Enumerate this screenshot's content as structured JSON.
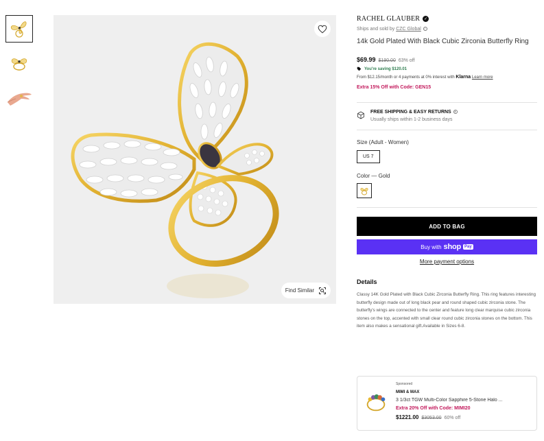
{
  "product": {
    "brand": "RACHEL GLAUBER",
    "sold_by_prefix": "Ships and sold by",
    "sold_by_link": "CZC Global",
    "title": "14k Gold Plated With Black Cubic Zirconia Butterfly Ring",
    "price": "$69.99",
    "price_old": "$190.00",
    "price_off": "63% off",
    "saving": "You're saving $120.01",
    "klarna_text": "From $12.15/month or 4 payments at 0% interest with",
    "klarna_brand": "Klarna",
    "klarna_learn": "Learn more",
    "promo": "Extra 15% Off with Code: GEN15"
  },
  "shipping": {
    "title": "FREE SHIPPING & EASY RETURNS",
    "subtitle": "Usually ships within 1-2 business days"
  },
  "size": {
    "label": "Size (Adult - Women)",
    "selected": "US 7"
  },
  "color": {
    "label": "Color — Gold"
  },
  "actions": {
    "add_to_bag": "ADD TO BAG",
    "buy_with": "Buy with",
    "shop_word": "shop",
    "pay_word": "Pay",
    "more_payment": "More payment options"
  },
  "gallery": {
    "find_similar": "Find Similar"
  },
  "details": {
    "heading": "Details",
    "text": "Classy 14K Gold Plated with Black Cubic Zirconia Butterfly Ring. This ring features interesting butterfly design made out of long black pear and round shaped cubic zirconia stone. The butterfly's wings are connected to the center and feature long clear marquise cubic zirconia stones on the top, accented with small clear round cubic zirconia stones on the bottom. This item also makes a sensational gift.Available in Sizes 6-8."
  },
  "sponsored": {
    "tag": "Sponsored",
    "brand": "MIMI & MAX",
    "title": "3 1/3ct TGW Multi-Color Sapphire 5-Stone Halo ...",
    "promo": "Extra 20% Off with Code: MIMI20",
    "price": "$1221.00",
    "price_old": "$3053.00",
    "price_off": "60% off"
  },
  "colors": {
    "accent_black": "#000000",
    "shop_pay_purple": "#5a31f4",
    "promo_pink": "#c2185b",
    "saving_green": "#2e7d4f",
    "gold": "#e8b830"
  },
  "icons": [
    "gold-butterfly-ring",
    "heart-icon",
    "find-similar-icon",
    "verified-icon",
    "box-icon",
    "tag-icon",
    "info-icon"
  ]
}
